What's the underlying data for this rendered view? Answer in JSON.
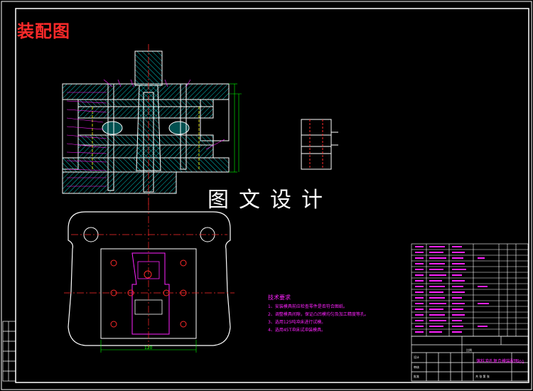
{
  "drawing": {
    "title": "装配图",
    "watermark": "图文设计",
    "notes": {
      "heading": "技术要求",
      "lines": [
        "1、安装模具前应检查零件是否符合图纸。",
        "2、调整模具间隙，保证凸凹模均匀及加工精度等孔。",
        "3、选用125吨冲床进行试模。",
        "4、选用45T冲床试冲装模具。"
      ]
    },
    "dimension": "120",
    "title_block": {
      "drawing_name": "落料冲孔复合模装配图",
      "drawing_code": "-01",
      "scale_label": "比例",
      "design_label": "设计",
      "check_label": "审核",
      "approve_label": "批准",
      "sheet_label": "共 张 第 张"
    },
    "colors": {
      "background": "#000000",
      "frame": "#ffffff",
      "lines": "#ffffff",
      "hatch": "#00c8c8",
      "centerline": "#ff2a2a",
      "hidden": "#ffff00",
      "dimension": "#00ff00",
      "text": "#ff22ff",
      "accent": "#ff2a2a"
    }
  }
}
